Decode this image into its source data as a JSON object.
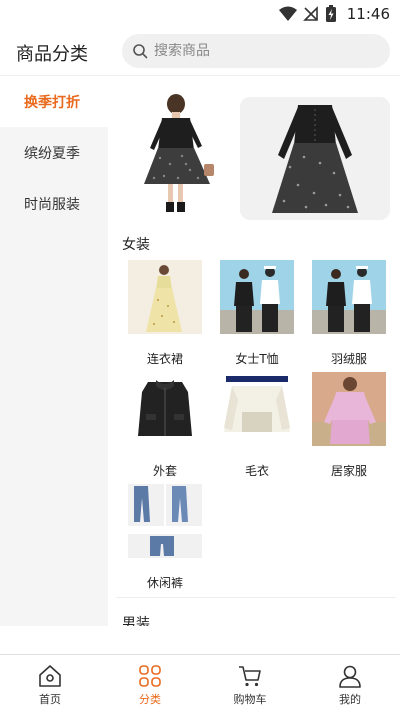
{
  "status": {
    "time": "11:46"
  },
  "header": {
    "title": "商品分类",
    "search_placeholder": "搜索商品"
  },
  "sidebar": {
    "items": [
      {
        "label": "换季打折",
        "active": true
      },
      {
        "label": "缤纷夏季",
        "active": false
      },
      {
        "label": "时尚服装",
        "active": false
      }
    ]
  },
  "content": {
    "sections": [
      {
        "title": "女装",
        "items": [
          {
            "label": "连衣裙"
          },
          {
            "label": "女士T恤"
          },
          {
            "label": "羽绒服"
          },
          {
            "label": "外套"
          },
          {
            "label": "毛衣"
          },
          {
            "label": "居家服"
          },
          {
            "label": "休闲裤"
          }
        ]
      },
      {
        "title": "男装"
      }
    ]
  },
  "bottom_nav": {
    "items": [
      {
        "label": "首页",
        "icon": "home-icon"
      },
      {
        "label": "分类",
        "icon": "category-icon"
      },
      {
        "label": "购物车",
        "icon": "cart-icon"
      },
      {
        "label": "我的",
        "icon": "user-icon"
      }
    ],
    "active_color": "#e96a1e"
  }
}
